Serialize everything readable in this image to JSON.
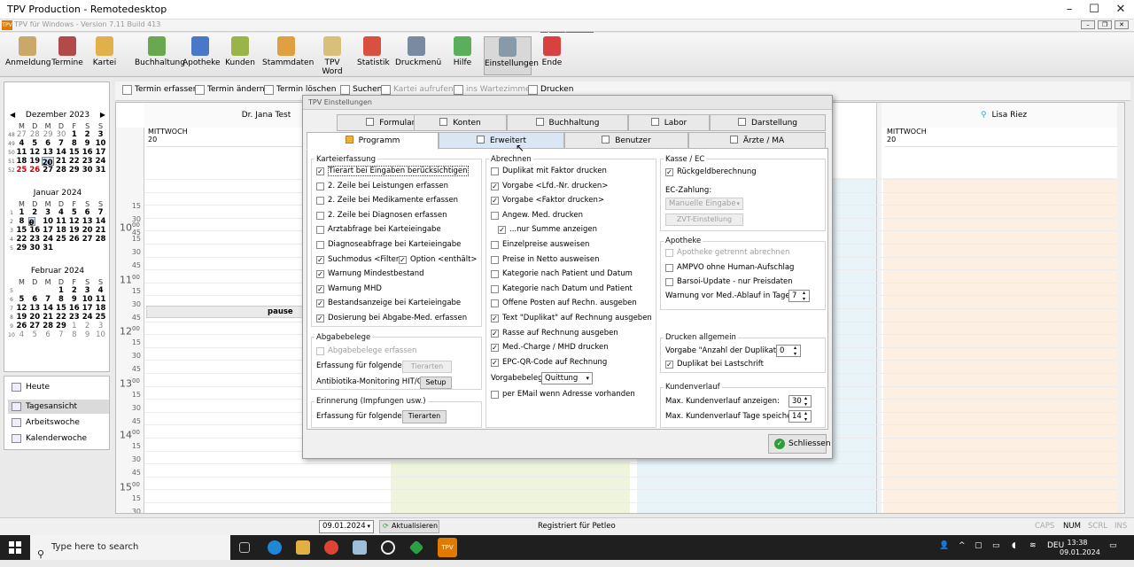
{
  "window": {
    "title": "TPV Production - Remotedesktop",
    "app_title": "TPV für Windows - Version 7.11 Build 413",
    "zoom_icon": "⚲",
    "more_icon": "⋯"
  },
  "toolbar": [
    {
      "label": "Anmeldung",
      "icon": "clipboard-icon",
      "color": "#c9a86a"
    },
    {
      "label": "Termine",
      "icon": "calendar-clock-icon",
      "color": "#b34a4a"
    },
    {
      "label": "Kartei",
      "icon": "folder-icon",
      "color": "#e2b04a"
    },
    {
      "label": "Buchhaltung",
      "icon": "ledger-icon",
      "color": "#6aa84f"
    },
    {
      "label": "Apotheke",
      "icon": "bottle-icon",
      "color": "#4a78c9"
    },
    {
      "label": "Kunden",
      "icon": "people-icon",
      "color": "#9ab44a"
    },
    {
      "label": "Stammdaten",
      "icon": "book-icon",
      "color": "#e0a040"
    },
    {
      "label": "TPV Word",
      "icon": "pencil-icon",
      "color": "#d9c07a"
    },
    {
      "label": "Statistik",
      "icon": "pie-chart-icon",
      "color": "#d95040"
    },
    {
      "label": "Druckmenü",
      "icon": "printer-icon",
      "color": "#7a8aa0"
    },
    {
      "label": "Hilfe",
      "icon": "help-globe-icon",
      "color": "#5ab05a"
    },
    {
      "label": "Einstellungen",
      "icon": "gear-icon",
      "color": "#8899aa"
    },
    {
      "label": "Ende",
      "icon": "exit-icon",
      "color": "#d94040"
    }
  ],
  "calendars": [
    {
      "title": "Dezember 2023",
      "weekdays": [
        "M",
        "D",
        "M",
        "D",
        "F",
        "S",
        "S"
      ],
      "weeks": [
        {
          "wk": "48",
          "days": [
            "27",
            "28",
            "29",
            "30",
            "1",
            "2",
            "3"
          ]
        },
        {
          "wk": "49",
          "days": [
            "4",
            "5",
            "6",
            "7",
            "8",
            "9",
            "10"
          ]
        },
        {
          "wk": "50",
          "days": [
            "11",
            "12",
            "13",
            "14",
            "15",
            "16",
            "17"
          ]
        },
        {
          "wk": "51",
          "days": [
            "18",
            "19",
            "20",
            "21",
            "22",
            "23",
            "24"
          ]
        },
        {
          "wk": "52",
          "days": [
            "25",
            "26",
            "27",
            "28",
            "29",
            "30",
            "31"
          ]
        }
      ]
    },
    {
      "title": "Januar 2024",
      "weekdays": [
        "M",
        "D",
        "M",
        "D",
        "F",
        "S",
        "S"
      ],
      "weeks": [
        {
          "wk": "1",
          "days": [
            "1",
            "2",
            "3",
            "4",
            "5",
            "6",
            "7"
          ]
        },
        {
          "wk": "2",
          "days": [
            "8",
            "9",
            "10",
            "11",
            "12",
            "13",
            "14"
          ]
        },
        {
          "wk": "3",
          "days": [
            "15",
            "16",
            "17",
            "18",
            "19",
            "20",
            "21"
          ]
        },
        {
          "wk": "4",
          "days": [
            "22",
            "23",
            "24",
            "25",
            "26",
            "27",
            "28"
          ]
        },
        {
          "wk": "5",
          "days": [
            "29",
            "30",
            "31",
            "",
            "",
            "",
            ""
          ]
        }
      ]
    },
    {
      "title": "Februar 2024",
      "weekdays": [
        "M",
        "D",
        "M",
        "D",
        "F",
        "S",
        "S"
      ],
      "weeks": [
        {
          "wk": "5",
          "days": [
            "",
            "",
            "",
            "1",
            "2",
            "3",
            "4"
          ]
        },
        {
          "wk": "6",
          "days": [
            "5",
            "6",
            "7",
            "8",
            "9",
            "10",
            "11"
          ]
        },
        {
          "wk": "7",
          "days": [
            "12",
            "13",
            "14",
            "15",
            "16",
            "17",
            "18"
          ]
        },
        {
          "wk": "8",
          "days": [
            "19",
            "20",
            "21",
            "22",
            "23",
            "24",
            "25"
          ]
        },
        {
          "wk": "9",
          "days": [
            "26",
            "27",
            "28",
            "29",
            "1",
            "2",
            "3"
          ]
        },
        {
          "wk": "10",
          "days": [
            "4",
            "5",
            "6",
            "7",
            "8",
            "9",
            "10"
          ]
        }
      ]
    }
  ],
  "left_nav": [
    {
      "label": "Heute",
      "icon": "today-icon"
    },
    {
      "label": "Tagesansicht",
      "icon": "day-view-icon"
    },
    {
      "label": "Arbeitswoche",
      "icon": "work-week-icon"
    },
    {
      "label": "Kalenderwoche",
      "icon": "calendar-week-icon"
    }
  ],
  "cal_toolbar": [
    {
      "label": "Termin erfassen",
      "disabled": false
    },
    {
      "label": "Termin ändern",
      "disabled": false
    },
    {
      "label": "Termin löschen",
      "disabled": false
    },
    {
      "label": "Suchen",
      "disabled": false
    },
    {
      "label": "Kartei aufrufen",
      "disabled": true
    },
    {
      "label": "ins Wartezimmer",
      "disabled": true
    },
    {
      "label": "Drucken",
      "disabled": false
    }
  ],
  "schedule": {
    "col1_doctor": "Dr. Jana Test",
    "col2_doctor": "Lisa Riez",
    "weekday": "MITTWOCH",
    "day": "20",
    "pause_label": "pause",
    "hours": [
      "10",
      "11",
      "12",
      "13",
      "14",
      "15"
    ],
    "minutes": [
      "15",
      "30",
      "45",
      "00"
    ]
  },
  "dialog": {
    "title": "TPV Einstellungen",
    "tabs_row1": [
      "Formulare",
      "Konten",
      "Buchhaltung",
      "Labor",
      "Darstellung"
    ],
    "tabs_row2": [
      "Programm",
      "Erweitert",
      "Benutzer",
      "Ärzte / MA"
    ],
    "karteierfassung": {
      "title": "Karteierfassung",
      "items": [
        {
          "label": "Tierart bei Eingaben berücksichtigen",
          "checked": true
        },
        {
          "label": "2. Zeile bei Leistungen erfassen",
          "checked": false
        },
        {
          "label": "2. Zeile bei Medikamente erfassen",
          "checked": false
        },
        {
          "label": "2. Zeile bei Diagnosen erfassen",
          "checked": false
        },
        {
          "label": "Arztabfrage bei Karteieingabe",
          "checked": false
        },
        {
          "label": "Diagnoseabfrage bei Karteieingabe",
          "checked": false
        },
        {
          "label": "Suchmodus <Filter>",
          "checked": true
        },
        {
          "label": "Warnung Mindestbestand",
          "checked": true
        },
        {
          "label": "Warnung MHD",
          "checked": true
        },
        {
          "label": "Bestandsanzeige bei Karteieingabe",
          "checked": true
        },
        {
          "label": "Dosierung bei Abgabe-Med. erfassen",
          "checked": true
        }
      ],
      "option_enthaelt": {
        "label": "Option <enthält>",
        "checked": true
      }
    },
    "abgabebelege": {
      "title": "Abgabebelege",
      "erfassen": {
        "label": "Abgabebelege erfassen",
        "checked": false,
        "disabled": true
      },
      "erfassung_label": "Erfassung für folgende...",
      "tierarten_btn": "Tierarten",
      "antibiotika_label": "Antibiotika-Monitoring HIT/QS:",
      "setup_btn": "Setup"
    },
    "erinnerung": {
      "title": "Erinnerung (Impfungen usw.)",
      "erfassung_label": "Erfassung für folgende...",
      "tierarten_btn": "Tierarten"
    },
    "abrechnen": {
      "title": "Abrechnen",
      "items": [
        {
          "label": "Duplikat mit Faktor drucken",
          "checked": false
        },
        {
          "label": "Vorgabe <Lfd.-Nr. drucken>",
          "checked": true
        },
        {
          "label": "Vorgabe <Faktor drucken>",
          "checked": true
        },
        {
          "label": "Angew. Med. drucken",
          "checked": false
        },
        {
          "label": "...nur Summe anzeigen",
          "checked": true
        },
        {
          "label": "Einzelpreise ausweisen",
          "checked": false
        },
        {
          "label": "Preise in Netto ausweisen",
          "checked": false
        },
        {
          "label": "Kategorie nach Patient und Datum",
          "checked": false
        },
        {
          "label": "Kategorie nach Datum und Patient",
          "checked": false
        },
        {
          "label": "Offene Posten auf Rechn. ausgeben",
          "checked": false
        },
        {
          "label": "Text \"Duplikat\" auf Rechnung ausgeben",
          "checked": true
        },
        {
          "label": "Rasse auf Rechnung ausgeben",
          "checked": true
        },
        {
          "label": "Med.-Charge / MHD drucken",
          "checked": true
        },
        {
          "label": "EPC-QR-Code auf Rechnung",
          "checked": true
        }
      ],
      "vorgabebeleg_label": "Vorgabebeleg:",
      "vorgabebeleg_value": "Quittung",
      "email": {
        "label": "per EMail wenn Adresse vorhanden",
        "checked": false
      }
    },
    "kasse": {
      "title": "Kasse / EC",
      "rueckgeld": {
        "label": "Rückgeldberechnung",
        "checked": true
      },
      "ec_label": "EC-Zahlung:",
      "ec_value": "Manuelle Eingabe",
      "zvt_btn": "ZVT-Einstellung"
    },
    "apotheke": {
      "title": "Apotheke",
      "getrennt": {
        "label": "Apotheke getrennt abrechnen",
        "checked": false,
        "disabled": true
      },
      "ampvo": {
        "label": "AMPVO ohne Human-Aufschlag",
        "checked": false
      },
      "barsoi": {
        "label": "Barsoi-Update - nur Preisdaten",
        "checked": false
      },
      "warnung_label": "Warnung vor Med.-Ablauf in Tagen",
      "warnung_value": "7"
    },
    "drucken": {
      "title": "Drucken allgemein",
      "vorgabe_label": "Vorgabe \"Anzahl der Duplikate\":",
      "vorgabe_value": "0",
      "lastschrift": {
        "label": "Duplikat bei Lastschrift",
        "checked": true
      }
    },
    "kundenverlauf": {
      "title": "Kundenverlauf",
      "max_anzeigen_label": "Max. Kundenverlauf anzeigen:",
      "max_anzeigen_value": "30",
      "max_tage_label": "Max. Kundenverlauf Tage speichern:",
      "max_tage_value": "14"
    },
    "close_btn": "Schliessen"
  },
  "statusbar": {
    "date": "09.01.2024",
    "refresh_btn": "Aktualisieren",
    "registered": "Registriert für Petleo",
    "caps": "CAPS",
    "num": "NUM",
    "scrl": "SCRL",
    "ins": "INS"
  },
  "taskbar": {
    "search_placeholder": "Type here to search",
    "lang": "DEU",
    "time": "13:38",
    "date": "09.01.2024"
  }
}
